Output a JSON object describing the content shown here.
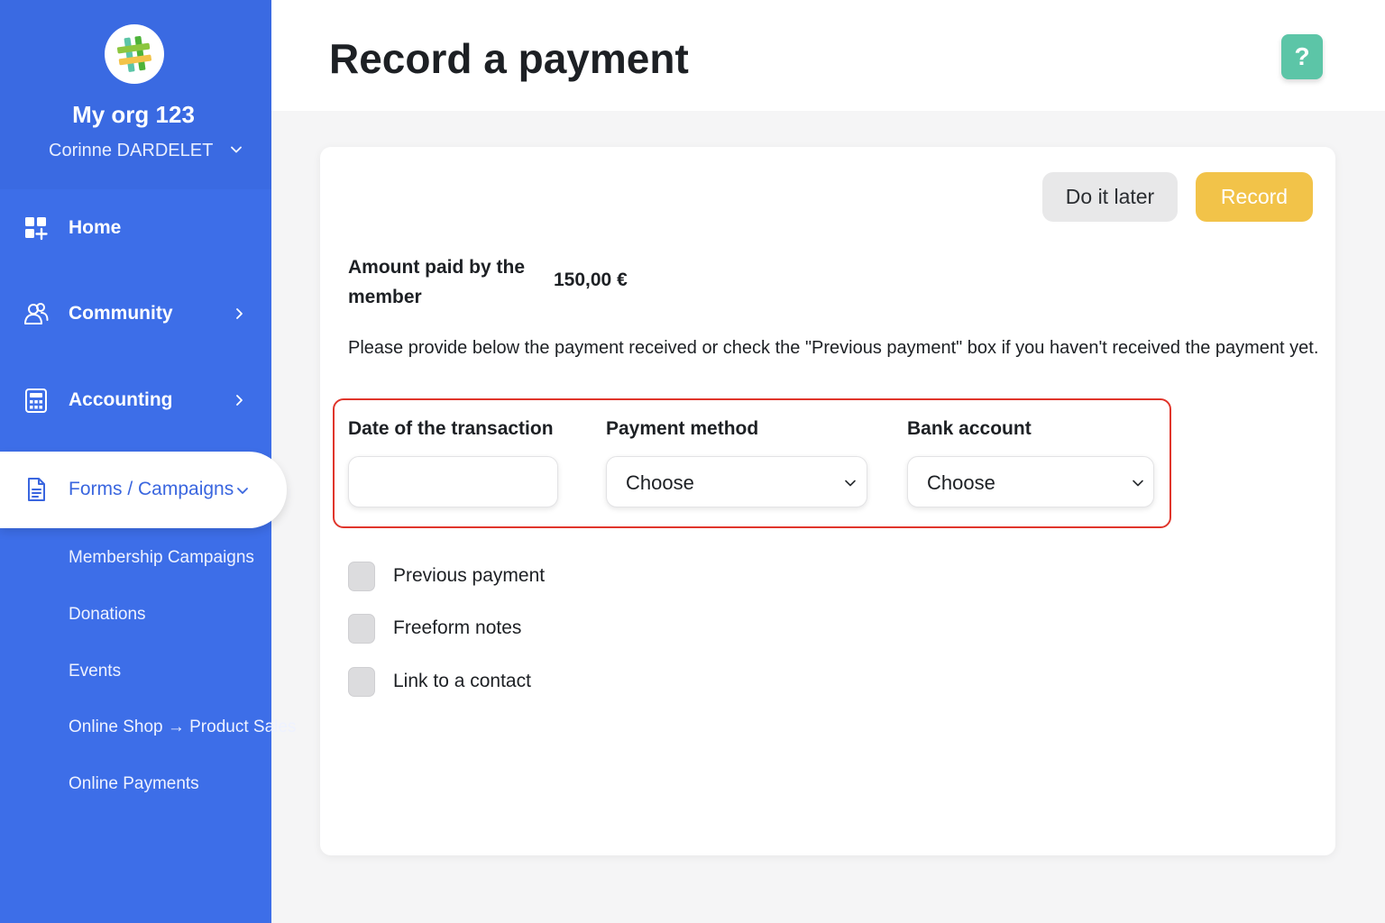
{
  "sidebar": {
    "org_name": "My org 123",
    "user_name": "Corinne DARDELET",
    "items": [
      {
        "label": "Home"
      },
      {
        "label": "Community"
      },
      {
        "label": "Accounting"
      },
      {
        "label": "Forms / Campaigns"
      }
    ],
    "sub_items": [
      {
        "label": "Membership Campaigns"
      },
      {
        "label": "Donations"
      },
      {
        "label": "Events"
      },
      {
        "label": "Online Shop → Product Sales"
      },
      {
        "label": "Online Payments"
      }
    ]
  },
  "header": {
    "title": "Record a payment",
    "help_label": "?"
  },
  "form": {
    "do_later_label": "Do it later",
    "record_label": "Record",
    "amount_label": "Amount paid by the member",
    "amount_value": "150,00 €",
    "instructions": "Please provide below the payment received or check the \"Previous payment\" box if you haven't received the payment yet.",
    "date_label": "Date of the transaction",
    "date_value": "",
    "method_label": "Payment method",
    "method_value": "Choose",
    "bank_label": "Bank account",
    "bank_value": "Choose",
    "checkboxes": [
      {
        "label": "Previous payment",
        "checked": false
      },
      {
        "label": "Freeform notes",
        "checked": false
      },
      {
        "label": "Link to a contact",
        "checked": false
      }
    ]
  },
  "colors": {
    "sidebar": "#3d6ee8",
    "accent_yellow": "#f2c349",
    "help_green": "#5cc5a7",
    "highlight_red": "#e0352b"
  }
}
